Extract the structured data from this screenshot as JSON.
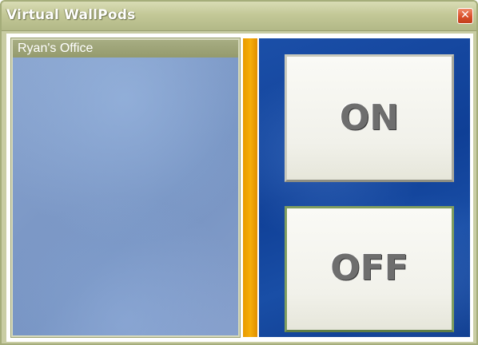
{
  "window": {
    "title": "Virtual WallPods",
    "close_glyph": "✕"
  },
  "rooms": [
    {
      "label": "Ryan's Office",
      "selected": true
    }
  ],
  "controls": {
    "on_label": "ON",
    "off_label": "OFF"
  },
  "colors": {
    "titlebar": "#c3c897",
    "separator": "#f6ae0a",
    "control_background": "#0f3f96",
    "room_panel_background": "#7c98c6",
    "selected_item": "#949a6d",
    "close_button": "#d9502b"
  },
  "icons": {
    "close": "close-icon"
  }
}
